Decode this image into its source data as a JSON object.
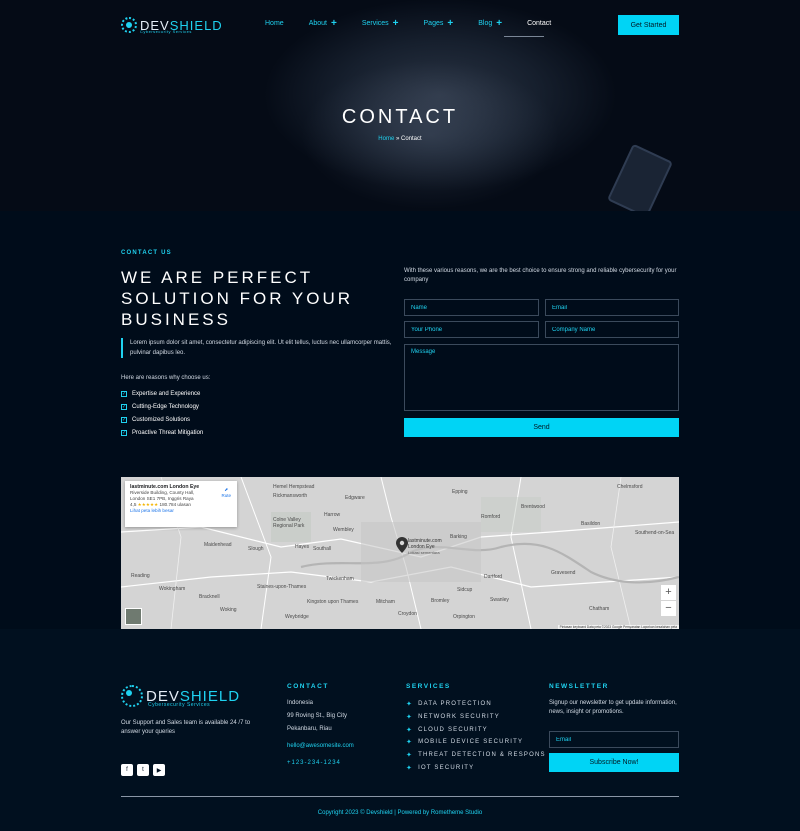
{
  "brand": {
    "name_main": "DEV",
    "name_accent": "SHIELD",
    "tagline": "Cybersecurity Services"
  },
  "nav": {
    "items": [
      {
        "label": "Home",
        "has_plus": false
      },
      {
        "label": "About",
        "has_plus": true
      },
      {
        "label": "Services",
        "has_plus": true
      },
      {
        "label": "Pages",
        "has_plus": true
      },
      {
        "label": "Blog",
        "has_plus": true
      },
      {
        "label": "Contact",
        "has_plus": false,
        "active": true
      }
    ],
    "cta": "Get Started"
  },
  "hero": {
    "title": "CONTACT",
    "breadcrumb_home": "Home",
    "breadcrumb_sep": "»",
    "breadcrumb_current": "Contact"
  },
  "contact": {
    "eyebrow": "CONTACT US",
    "headline": "WE ARE PERFECT SOLUTION FOR YOUR BUSINESS",
    "quote": "Lorem ipsum dolor sit amet, consectetur adipiscing elit. Ut elit tellus, luctus nec ullamcorper mattis, pulvinar dapibus leo.",
    "reasons_title": "Here are reasons why choose us:",
    "reasons": [
      "Expertise and Experience",
      "Cutting-Edge Technology",
      "Customized Solutions",
      "Proactive Threat Mitigation"
    ],
    "form_intro": "With these various reasons, we are the best choice to ensure strong and reliable cybersecurity for your company",
    "form": {
      "name_placeholder": "Name",
      "email_placeholder": "Email",
      "phone_placeholder": "Your Phone",
      "company_placeholder": "Company Name",
      "message_placeholder": "Message",
      "send_label": "Send"
    }
  },
  "map": {
    "place_name": "lastminute.com London Eye",
    "address_line1": "Riverside Building, County Hall,",
    "address_line2": "London SE1 7PB, Inggris Raya",
    "rating": "4,5",
    "stars": "★★★★★",
    "reviews": "180.784 ulasan",
    "directions": "Rute",
    "larger_map": "Lihat peta lebih besar",
    "pin_label_1": "lastminute.com",
    "pin_label_2": "London Eye",
    "pin_label_3": "Lokasi sementara",
    "zoom_in": "+",
    "zoom_out": "−",
    "footer_text": "Pintasan keyboard   Data peta ©2023 Google   Persyaratan   Laporkan kesalahan peta",
    "places": [
      {
        "name": "Hemel Hempstead",
        "pos": "a"
      },
      {
        "name": "Rickmansworth",
        "pos": "b"
      },
      {
        "name": "Edgware",
        "pos": "c"
      },
      {
        "name": "Harrow",
        "pos": "d"
      },
      {
        "name": "Wembley",
        "pos": "e"
      },
      {
        "name": "Colne Valley Regional Park",
        "pos": "f"
      },
      {
        "name": "Hayes",
        "pos": "g"
      },
      {
        "name": "Southall",
        "pos": "h"
      },
      {
        "name": "Slough",
        "pos": "i"
      },
      {
        "name": "Maidenhead",
        "pos": "j"
      },
      {
        "name": "Reading",
        "pos": "k"
      },
      {
        "name": "Wokingham",
        "pos": "l"
      },
      {
        "name": "Bracknell",
        "pos": "m"
      },
      {
        "name": "Staines-upon-Thames",
        "pos": "n"
      },
      {
        "name": "Twickenham",
        "pos": "o"
      },
      {
        "name": "Kingston upon Thames",
        "pos": "p"
      },
      {
        "name": "Mitcham",
        "pos": "q"
      },
      {
        "name": "Croydon",
        "pos": "r"
      },
      {
        "name": "Bromley",
        "pos": "s"
      },
      {
        "name": "Sidcup",
        "pos": "t"
      },
      {
        "name": "Romford",
        "pos": "u"
      },
      {
        "name": "Barking",
        "pos": "v"
      },
      {
        "name": "Dartford",
        "pos": "w"
      },
      {
        "name": "Basildon",
        "pos": "x"
      },
      {
        "name": "Southend-on-Sea",
        "pos": "y"
      },
      {
        "name": "Chelmsford",
        "pos": "z"
      },
      {
        "name": "Brentwood",
        "pos": "aa"
      },
      {
        "name": "Gravesend",
        "pos": "ab"
      },
      {
        "name": "Chatham",
        "pos": "ac"
      },
      {
        "name": "Orpington",
        "pos": "ad"
      },
      {
        "name": "Swanley",
        "pos": "ae"
      },
      {
        "name": "Epping",
        "pos": "af"
      },
      {
        "name": "Weybridge",
        "pos": "ag"
      },
      {
        "name": "Woking",
        "pos": "ah"
      }
    ]
  },
  "footer": {
    "support_text": "Our Support and Sales team is available 24 /7 to answer your queries",
    "social": [
      "f",
      "t",
      "▶"
    ],
    "contact": {
      "heading": "CONTACT",
      "country": "Indonesia",
      "street": "99 Roving St., Big City",
      "city": "Pekanbaru, Riau",
      "email": "hello@awesomesite.com",
      "phone": "+123-234-1234"
    },
    "services": {
      "heading": "SERVICES",
      "items": [
        "DATA PROTECTION",
        "NETWORK SECURITY",
        "CLOUD SECURITY",
        "MOBILE DEVICE SECURITY",
        "THREAT DETECTION & RESPONS",
        "IOT SECURITY"
      ]
    },
    "newsletter": {
      "heading": "NEWSLETTER",
      "text": "Signup our newsletter to get update information, news, insight or promotions.",
      "email_placeholder": "Email",
      "button": "Subscribe Now!"
    },
    "copyright": "Copyright 2023 © Devshield | Powered by Rometheme Studio"
  },
  "colors": {
    "accent": "#00d4f5",
    "background": "#000c1a",
    "footer_bg": "#01101f"
  }
}
